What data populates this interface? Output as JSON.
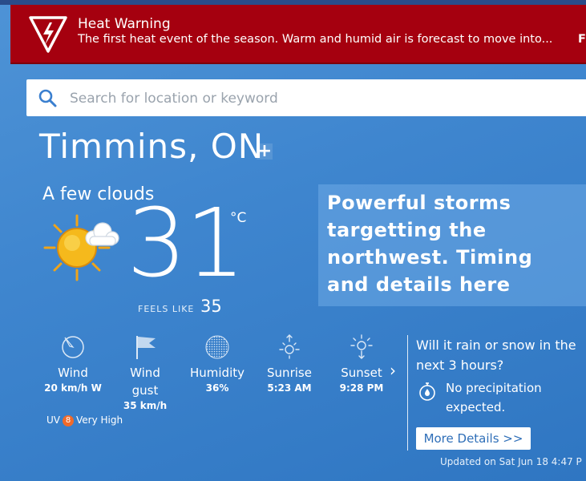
{
  "alert": {
    "title": "Heat Warning",
    "text": "The first heat event of the season. Warm and humid air is forecast to move into...",
    "more": "F",
    "icon": "heat-warning-icon",
    "color": "#a5000f"
  },
  "search": {
    "placeholder": "Search for location or keyword",
    "icon": "search-icon"
  },
  "location": {
    "name": "Timmins, ON",
    "add_label": "+"
  },
  "current": {
    "condition": "A few clouds",
    "icon": "sun-cloud-icon",
    "temperature": "31",
    "unit": "°C",
    "feels_like_label": "FEELS LIKE",
    "feels_like_value": "35"
  },
  "story": {
    "headline": "Powerful storms targetting the northwest. Timing and details here"
  },
  "stats": [
    {
      "label": "Wind",
      "value": "20 km/h W",
      "icon": "wind-dial-icon"
    },
    {
      "label": "Wind gust",
      "value": "35 km/h",
      "icon": "flag-icon"
    },
    {
      "label": "Humidity",
      "value": "36%",
      "icon": "humidity-icon"
    },
    {
      "label": "Sunrise",
      "value": "5:23 AM",
      "icon": "sunrise-icon"
    },
    {
      "label": "Sunset",
      "value": "9:28 PM",
      "icon": "sunset-icon"
    }
  ],
  "more_chevron": "›",
  "uv": {
    "label": "UV",
    "index": "8",
    "level": "Very High",
    "badge_color": "#f06a2a"
  },
  "precip": {
    "question": "Will it rain or snow in the next 3 hours?",
    "answer": "No precipitation expected.",
    "icon": "stopwatch-drop-icon",
    "button": "More Details >>"
  },
  "updated": "Updated on Sat Jun 18 4:47 P"
}
